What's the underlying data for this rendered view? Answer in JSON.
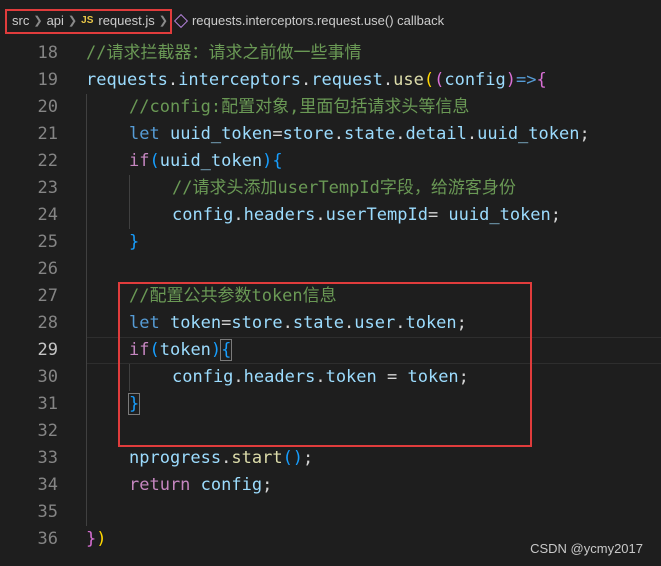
{
  "breadcrumb": {
    "items": [
      "src",
      "api",
      "request.js",
      "requests.interceptors.request.use() callback"
    ],
    "file_badge": "JS"
  },
  "editor": {
    "lines": [
      {
        "num": "18",
        "indent": 0,
        "tokens": [
          {
            "t": "com",
            "v": "//请求拦截器：请求之前做一些事情"
          }
        ]
      },
      {
        "num": "19",
        "indent": 0,
        "tokens": [
          {
            "t": "var",
            "v": "requests"
          },
          {
            "t": "pun",
            "v": "."
          },
          {
            "t": "var",
            "v": "interceptors"
          },
          {
            "t": "pun",
            "v": "."
          },
          {
            "t": "var",
            "v": "request"
          },
          {
            "t": "pun",
            "v": "."
          },
          {
            "t": "fn",
            "v": "use"
          },
          {
            "t": "b1",
            "v": "("
          },
          {
            "t": "b2",
            "v": "("
          },
          {
            "t": "var",
            "v": "config"
          },
          {
            "t": "b2",
            "v": ")"
          },
          {
            "t": "kw",
            "v": "=>"
          },
          {
            "t": "b2",
            "v": "{"
          }
        ]
      },
      {
        "num": "20",
        "indent": 1,
        "tokens": [
          {
            "t": "com",
            "v": "//config:配置对象,里面包括请求头等信息"
          }
        ]
      },
      {
        "num": "21",
        "indent": 1,
        "tokens": [
          {
            "t": "kw",
            "v": "let "
          },
          {
            "t": "var",
            "v": "uuid_token"
          },
          {
            "t": "pun",
            "v": "="
          },
          {
            "t": "var",
            "v": "store"
          },
          {
            "t": "pun",
            "v": "."
          },
          {
            "t": "var",
            "v": "state"
          },
          {
            "t": "pun",
            "v": "."
          },
          {
            "t": "var",
            "v": "detail"
          },
          {
            "t": "pun",
            "v": "."
          },
          {
            "t": "var",
            "v": "uuid_token"
          },
          {
            "t": "pun",
            "v": ";"
          }
        ]
      },
      {
        "num": "22",
        "indent": 1,
        "tokens": [
          {
            "t": "ctrl",
            "v": "if"
          },
          {
            "t": "b3",
            "v": "("
          },
          {
            "t": "var",
            "v": "uuid_token"
          },
          {
            "t": "b3",
            "v": ")"
          },
          {
            "t": "b3",
            "v": "{"
          }
        ]
      },
      {
        "num": "23",
        "indent": 2,
        "tokens": [
          {
            "t": "com",
            "v": "//请求头添加userTempId字段，给游客身份"
          }
        ]
      },
      {
        "num": "24",
        "indent": 2,
        "tokens": [
          {
            "t": "var",
            "v": "config"
          },
          {
            "t": "pun",
            "v": "."
          },
          {
            "t": "var",
            "v": "headers"
          },
          {
            "t": "pun",
            "v": "."
          },
          {
            "t": "var",
            "v": "userTempId"
          },
          {
            "t": "pun",
            "v": "= "
          },
          {
            "t": "var",
            "v": "uuid_token"
          },
          {
            "t": "pun",
            "v": ";"
          }
        ]
      },
      {
        "num": "25",
        "indent": 1,
        "tokens": [
          {
            "t": "b3",
            "v": "}"
          }
        ]
      },
      {
        "num": "26",
        "indent": 1,
        "tokens": []
      },
      {
        "num": "27",
        "indent": 1,
        "tokens": [
          {
            "t": "com",
            "v": "//配置公共参数token信息"
          }
        ]
      },
      {
        "num": "28",
        "indent": 1,
        "tokens": [
          {
            "t": "kw",
            "v": "let "
          },
          {
            "t": "var",
            "v": "token"
          },
          {
            "t": "pun",
            "v": "="
          },
          {
            "t": "var",
            "v": "store"
          },
          {
            "t": "pun",
            "v": "."
          },
          {
            "t": "var",
            "v": "state"
          },
          {
            "t": "pun",
            "v": "."
          },
          {
            "t": "var",
            "v": "user"
          },
          {
            "t": "pun",
            "v": "."
          },
          {
            "t": "var",
            "v": "token"
          },
          {
            "t": "pun",
            "v": ";"
          }
        ]
      },
      {
        "num": "29",
        "indent": 1,
        "active": true,
        "tokens": [
          {
            "t": "ctrl",
            "v": "if"
          },
          {
            "t": "b3",
            "v": "("
          },
          {
            "t": "var",
            "v": "token"
          },
          {
            "t": "b3",
            "v": ")"
          },
          {
            "t": "b3",
            "v": "{",
            "match": true
          }
        ]
      },
      {
        "num": "30",
        "indent": 2,
        "tokens": [
          {
            "t": "var",
            "v": "config"
          },
          {
            "t": "pun",
            "v": "."
          },
          {
            "t": "var",
            "v": "headers"
          },
          {
            "t": "pun",
            "v": "."
          },
          {
            "t": "var",
            "v": "token"
          },
          {
            "t": "pun",
            "v": " = "
          },
          {
            "t": "var",
            "v": "token"
          },
          {
            "t": "pun",
            "v": ";"
          }
        ]
      },
      {
        "num": "31",
        "indent": 1,
        "tokens": [
          {
            "t": "b3",
            "v": "}",
            "match": true
          }
        ]
      },
      {
        "num": "32",
        "indent": 1,
        "tokens": []
      },
      {
        "num": "33",
        "indent": 1,
        "tokens": [
          {
            "t": "var",
            "v": "nprogress"
          },
          {
            "t": "pun",
            "v": "."
          },
          {
            "t": "fn",
            "v": "start"
          },
          {
            "t": "b3",
            "v": "()"
          },
          {
            "t": "pun",
            "v": ";"
          }
        ]
      },
      {
        "num": "34",
        "indent": 1,
        "tokens": [
          {
            "t": "ctrl",
            "v": "return "
          },
          {
            "t": "var",
            "v": "config"
          },
          {
            "t": "pun",
            "v": ";"
          }
        ]
      },
      {
        "num": "35",
        "indent": 1,
        "tokens": []
      },
      {
        "num": "36",
        "indent": 0,
        "tokens": [
          {
            "t": "b2",
            "v": "}"
          },
          {
            "t": "b1",
            "v": ")"
          }
        ]
      }
    ]
  },
  "watermark": "CSDN @ycmy2017"
}
